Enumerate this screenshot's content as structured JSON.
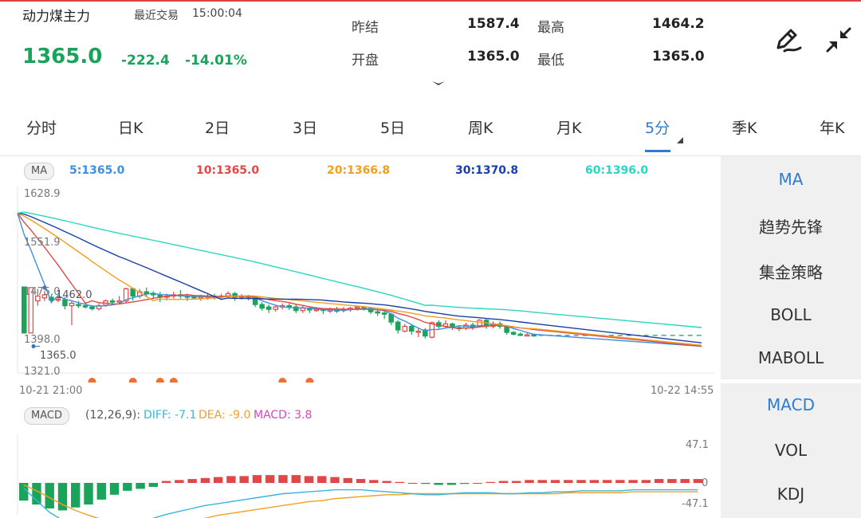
{
  "header": {
    "name": "动力煤主力",
    "last_trade_label": "最近交易",
    "last_trade_time": "15:00:04",
    "price": "1365.0",
    "change": "-222.4",
    "change_pct": "-14.01%",
    "quotes": [
      {
        "label": "昨结",
        "value": "1587.4"
      },
      {
        "label": "最高",
        "value": "1464.2"
      },
      {
        "label": "开盘",
        "value": "1365.0"
      },
      {
        "label": "最低",
        "value": "1365.0"
      }
    ],
    "edit_icon": "pencil-icon",
    "collapse_icon": "collapse-arrows-icon",
    "expand_icon": "chevron-down-icon"
  },
  "tabs": [
    "分时",
    "日K",
    "2日",
    "3日",
    "5日",
    "周K",
    "月K",
    "5分",
    "季K",
    "年K"
  ],
  "active_tab": "5分",
  "ma_legend": {
    "tag": "MA",
    "items": [
      {
        "text": "5:1365.0",
        "color": "#3f8fe0"
      },
      {
        "text": "10:1365.0",
        "color": "#e04848"
      },
      {
        "text": "20:1366.8",
        "color": "#f0a020"
      },
      {
        "text": "30:1370.8",
        "color": "#1a3fa8"
      },
      {
        "text": "60:1396.0",
        "color": "#2ad6c0"
      }
    ]
  },
  "price_axis": {
    "ticks": [
      "1628.9",
      "1551.9",
      "1475.0",
      "1398.0",
      "1321.0"
    ],
    "high_marker": "1462.0",
    "low_marker": "1365.0"
  },
  "time_axis": {
    "start": "10-21 21:00",
    "end": "10-22 14:55"
  },
  "macd_legend": {
    "tag": "MACD",
    "params": "(12,26,9):",
    "diff": "DIFF: -7.1",
    "dea": "DEA: -9.0",
    "macd": "MACD: 3.8",
    "diff_color": "#3ab4d8",
    "dea_color": "#f0a020",
    "macd_color": "#e040c0"
  },
  "macd_axis": {
    "top": "47.1",
    "zero": "0",
    "bottom": "-47.1"
  },
  "side_menu": {
    "top": [
      "MA",
      "趋势先锋",
      "集金策略",
      "BOLL",
      "MABOLL"
    ],
    "bottom": [
      "MACD",
      "VOL",
      "KDJ"
    ],
    "active_top": "MA",
    "active_bottom": "MACD"
  },
  "colors": {
    "up": "#e04848",
    "down": "#1aa35a",
    "accent": "#2f7bd3",
    "signal_dot": "#f07030"
  },
  "chart_data": {
    "type": "candlestick",
    "y_range": [
      1321.0,
      1628.9
    ],
    "candles": [
      [
        1463,
        1387,
        1463,
        1387
      ],
      [
        1387,
        1462,
        1462,
        1420
      ],
      [
        1440,
        1448,
        1460,
        1432
      ],
      [
        1445,
        1450,
        1456,
        1440
      ],
      [
        1446,
        1441,
        1450,
        1436
      ],
      [
        1441,
        1443,
        1447,
        1438
      ],
      [
        1442,
        1432,
        1446,
        1426
      ],
      [
        1432,
        1436,
        1440,
        1400
      ],
      [
        1434,
        1432,
        1440,
        1428
      ],
      [
        1432,
        1430,
        1436,
        1427
      ],
      [
        1430,
        1427,
        1433,
        1424
      ],
      [
        1427,
        1432,
        1436,
        1424
      ],
      [
        1433,
        1440,
        1442,
        1430
      ],
      [
        1440,
        1438,
        1444,
        1434
      ],
      [
        1438,
        1440,
        1448,
        1434
      ],
      [
        1440,
        1460,
        1462,
        1436
      ],
      [
        1460,
        1448,
        1462,
        1440
      ],
      [
        1448,
        1455,
        1460,
        1444
      ],
      [
        1455,
        1452,
        1462,
        1446
      ],
      [
        1452,
        1450,
        1456,
        1444
      ],
      [
        1450,
        1446,
        1455,
        1438
      ],
      [
        1446,
        1448,
        1452,
        1441
      ],
      [
        1448,
        1450,
        1455,
        1444
      ],
      [
        1450,
        1448,
        1458,
        1444
      ],
      [
        1448,
        1447,
        1452,
        1440
      ],
      [
        1447,
        1445,
        1450,
        1442
      ],
      [
        1445,
        1446,
        1450,
        1440
      ],
      [
        1446,
        1448,
        1452,
        1442
      ],
      [
        1448,
        1446,
        1452,
        1442
      ],
      [
        1446,
        1448,
        1452,
        1443
      ],
      [
        1448,
        1452,
        1456,
        1444
      ],
      [
        1452,
        1446,
        1455,
        1440
      ],
      [
        1446,
        1448,
        1451,
        1442
      ],
      [
        1448,
        1446,
        1450,
        1441
      ],
      [
        1446,
        1434,
        1448,
        1430
      ],
      [
        1434,
        1428,
        1438,
        1424
      ],
      [
        1430,
        1426,
        1434,
        1420
      ],
      [
        1426,
        1430,
        1433,
        1422
      ],
      [
        1430,
        1432,
        1436,
        1426
      ],
      [
        1432,
        1430,
        1436,
        1425
      ],
      [
        1430,
        1424,
        1434,
        1420
      ],
      [
        1424,
        1428,
        1432,
        1420
      ],
      [
        1428,
        1425,
        1431,
        1420
      ],
      [
        1425,
        1426,
        1430,
        1422
      ],
      [
        1426,
        1424,
        1428,
        1418
      ],
      [
        1424,
        1425,
        1429,
        1420
      ],
      [
        1425,
        1424,
        1430,
        1420
      ],
      [
        1424,
        1426,
        1430,
        1421
      ],
      [
        1426,
        1428,
        1430,
        1422
      ],
      [
        1428,
        1430,
        1432,
        1424
      ],
      [
        1430,
        1428,
        1432,
        1424
      ],
      [
        1428,
        1422,
        1430,
        1418
      ],
      [
        1422,
        1420,
        1426,
        1415
      ],
      [
        1420,
        1418,
        1424,
        1410
      ],
      [
        1418,
        1405,
        1420,
        1400
      ],
      [
        1405,
        1392,
        1408,
        1386
      ],
      [
        1390,
        1398,
        1402,
        1388
      ],
      [
        1398,
        1390,
        1402,
        1384
      ],
      [
        1390,
        1390,
        1394,
        1380
      ],
      [
        1392,
        1382,
        1395,
        1378
      ],
      [
        1380,
        1404,
        1406,
        1378
      ],
      [
        1404,
        1398,
        1408,
        1394
      ],
      [
        1398,
        1402,
        1408,
        1394
      ],
      [
        1402,
        1396,
        1404,
        1392
      ],
      [
        1396,
        1395,
        1400,
        1390
      ],
      [
        1395,
        1400,
        1404,
        1392
      ],
      [
        1400,
        1396,
        1404,
        1392
      ],
      [
        1398,
        1408,
        1410,
        1396
      ],
      [
        1408,
        1398,
        1410,
        1394
      ],
      [
        1398,
        1402,
        1406,
        1395
      ],
      [
        1402,
        1398,
        1406,
        1394
      ],
      [
        1398,
        1388,
        1400,
        1384
      ],
      [
        1388,
        1385,
        1390,
        1383
      ],
      [
        1385,
        1384,
        1388,
        1382
      ],
      [
        1384,
        1384,
        1387,
        1382
      ],
      [
        1384,
        1383,
        1386,
        1381
      ]
    ],
    "signal_markers_at": [
      10,
      16,
      20,
      22,
      38,
      42
    ],
    "macd": {
      "hist": [
        -18,
        -22,
        -26,
        -28,
        -25,
        -22,
        -17,
        -12,
        -8,
        -6,
        -4,
        2,
        3,
        4,
        5,
        6,
        7,
        7,
        8,
        8,
        8,
        8,
        7,
        7,
        6,
        5,
        4,
        3,
        2,
        1,
        0,
        -1,
        -2,
        -2,
        -1,
        0,
        1,
        2,
        2,
        3,
        3,
        3,
        3,
        3,
        3,
        3,
        3,
        3,
        3,
        4,
        4,
        4,
        4
      ],
      "diff": [
        -5,
        -18,
        -30,
        -38,
        -42,
        -44,
        -45,
        -44,
        -42,
        -39,
        -36,
        -32,
        -29,
        -26,
        -23,
        -21,
        -19,
        -17,
        -15,
        -13,
        -11,
        -10,
        -9,
        -8,
        -7,
        -7,
        -7,
        -8,
        -9,
        -10,
        -11,
        -12,
        -12,
        -11,
        -10,
        -10,
        -10,
        -11,
        -11,
        -10,
        -10,
        -9,
        -9,
        -8,
        -8,
        -8,
        -8,
        -7,
        -7,
        -7,
        -7,
        -7,
        -7
      ],
      "dea": [
        -2,
        -8,
        -15,
        -22,
        -28,
        -33,
        -37,
        -40,
        -42,
        -43,
        -43,
        -42,
        -40,
        -38,
        -36,
        -33,
        -31,
        -29,
        -27,
        -25,
        -23,
        -21,
        -19,
        -18,
        -16,
        -15,
        -14,
        -13,
        -12,
        -12,
        -11,
        -11,
        -11,
        -11,
        -11,
        -11,
        -11,
        -11,
        -11,
        -11,
        -11,
        -11,
        -10,
        -10,
        -10,
        -10,
        -10,
        -9,
        -9,
        -9,
        -9,
        -9,
        -9
      ],
      "y_range": [
        -47.1,
        47.1
      ]
    }
  }
}
